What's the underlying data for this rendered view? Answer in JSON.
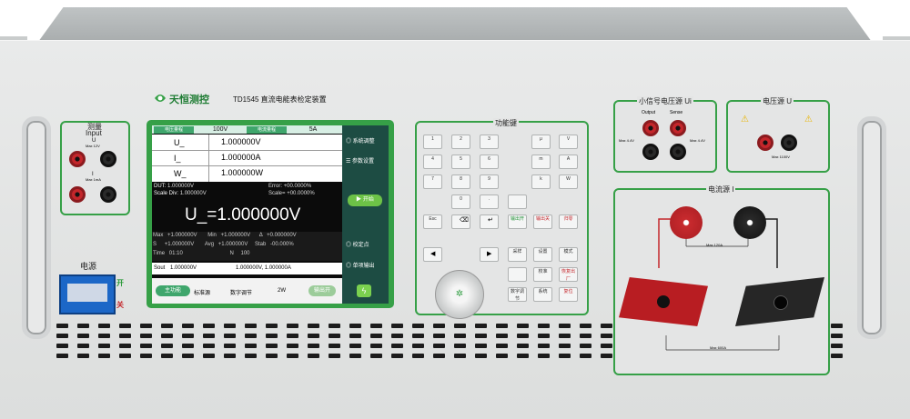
{
  "brand": {
    "name": "天恒测控"
  },
  "model": {
    "title": "TD1545 直流电能表检定装置"
  },
  "measure_panel": {
    "title": "测量",
    "subtitle": "Input",
    "u_label": "U",
    "u_max": "Max 12V",
    "i_label": "I",
    "i_max": "Max 1mA"
  },
  "power": {
    "label": "电源",
    "on": "开",
    "off": "关"
  },
  "function_keys": {
    "title": "功能键",
    "numeric": [
      {
        "main": "1",
        "sub": ""
      },
      {
        "main": "2",
        "sub": ""
      },
      {
        "main": "3",
        "sub": ""
      },
      {
        "main": "4",
        "sub": ""
      },
      {
        "main": "5",
        "sub": ""
      },
      {
        "main": "6",
        "sub": ""
      },
      {
        "main": "7",
        "sub": ""
      },
      {
        "main": "8",
        "sub": ""
      },
      {
        "main": "9",
        "sub": ""
      },
      {
        "main": "0",
        "sub": ""
      },
      {
        "main": ".",
        "sub": ""
      }
    ],
    "units": [
      "μ",
      "V",
      "m",
      "A",
      "k",
      "W"
    ],
    "esc": "Esc",
    "row_green_red": [
      "输出开",
      "输出关",
      "归零"
    ],
    "grid": [
      "采样",
      "设置",
      "模式",
      "校准",
      "恢复出厂",
      "数字调节",
      "系统",
      "复位"
    ]
  },
  "screen": {
    "tabs": [
      "电压量程",
      "100V",
      "电流量程",
      "5A"
    ],
    "readings": [
      {
        "label": "U_",
        "value": "1.000000V"
      },
      {
        "label": "I_",
        "value": "1.000000A"
      },
      {
        "label": "W_",
        "value": "1.000000W"
      }
    ],
    "dut_label": "DUT:",
    "dut_value": "1.000000V",
    "error_label": "Error:",
    "error_value": "+00.0000%",
    "scale_label": "Scale Div:",
    "scale_value": "1.000000V",
    "scale2_label": "Scale=",
    "scale2_value": "+00.0000%",
    "big_value": "U_=1.000000V",
    "stats": [
      [
        "Max",
        "+1.000000V",
        "Min",
        "+1.000000V",
        "Δ",
        "+0.000000V"
      ],
      [
        "S",
        "+1.000000V",
        "Avg",
        "+1.000000V",
        "Stab",
        "-00.000%"
      ],
      [
        "Time",
        "01:10",
        "",
        "N",
        "100",
        ""
      ]
    ],
    "bottom_label": "Sout",
    "bottom_v": "1.000000V",
    "bottom_pair": "1.000000V, 1.000000A",
    "footer": [
      "主功能",
      "标准源",
      "数字调节",
      "2W",
      "输出开"
    ],
    "menu": [
      "系统调整",
      "参数设置",
      "开始",
      "校定点",
      "单项输出"
    ]
  },
  "small_voltage": {
    "title": "小信号电压源 Ui",
    "output": "Output",
    "sense": "Sense",
    "max": "Max 4.4V"
  },
  "voltage_source": {
    "title": "电压源 U",
    "max": "Max 1100V"
  },
  "current_source": {
    "title": "电流源 I",
    "max_small": "Max 120A",
    "max_large": "Max 600A"
  },
  "colors": {
    "accent": "#36a047",
    "jack_red": "#c4262b",
    "panel": "#e2e3e3"
  }
}
